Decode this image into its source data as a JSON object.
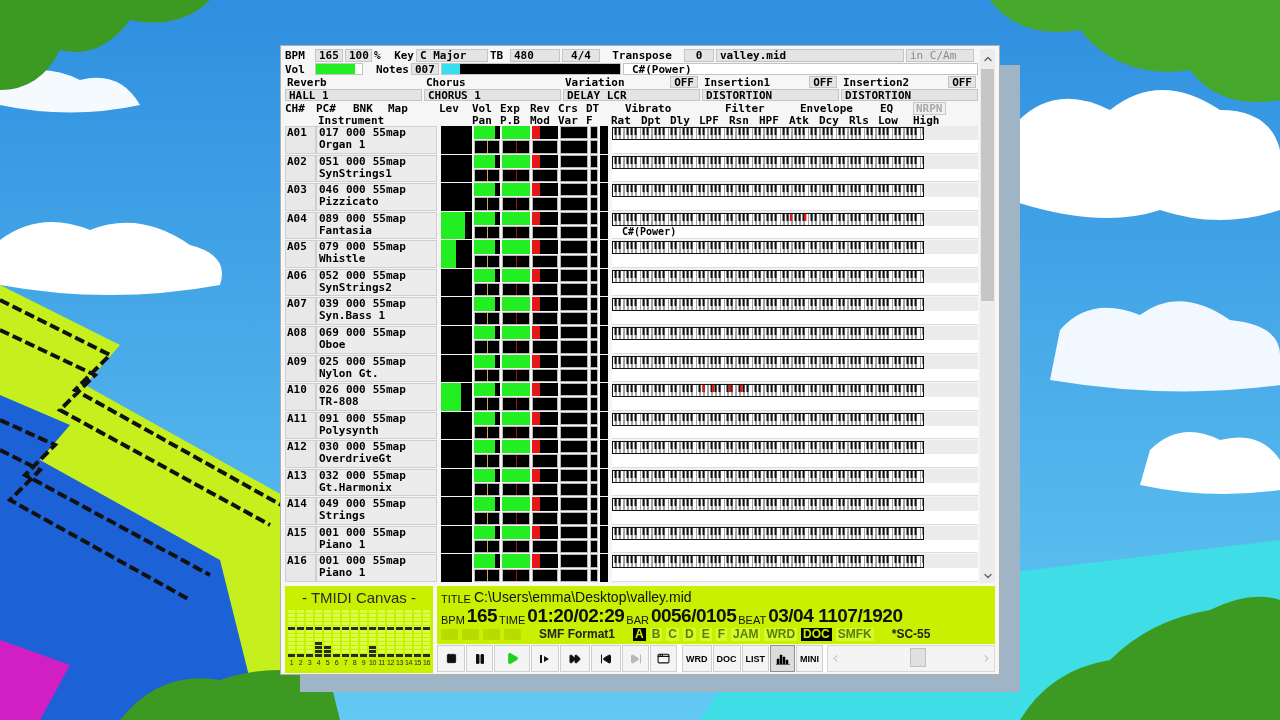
{
  "header": {
    "bpm_label": "BPM",
    "bpm": "165",
    "tempo": "100",
    "percent": "%",
    "key_label": "Key",
    "key": "C Major",
    "tb_label": "TB",
    "tb": "480",
    "time_signature": "4/4",
    "transpose_label": "Transpose",
    "transpose": "0",
    "file": "valley.mid",
    "key_hint": "in C/Am",
    "vol_label": "Vol",
    "vol": {
      "level": 0.85
    },
    "notes_label": "Notes",
    "notes": "007",
    "notes_meter": {
      "level": 0.1
    },
    "chord": "C#(Power)"
  },
  "effects": [
    {
      "label": "Reverb",
      "value": "HALL 1"
    },
    {
      "label": "Chorus",
      "value": "CHORUS 1"
    },
    {
      "label": "Variation",
      "switch": "OFF",
      "on": false,
      "value": "DELAY LCR"
    },
    {
      "label": "Insertion1",
      "switch": "OFF",
      "on": false,
      "value": "DISTORTION"
    },
    {
      "label": "Insertion2",
      "switch": "OFF",
      "on": false,
      "value": "DISTORTION"
    }
  ],
  "columns_top": [
    "CH#",
    "PC#",
    "BNK",
    "Map",
    "Lev",
    "Vol",
    "Exp",
    "Rev",
    "Crs",
    "DT",
    "Vibrato",
    "Filter",
    "Envelope",
    "EQ"
  ],
  "nrpn": {
    "label": "NRPN",
    "disabled": true
  },
  "columns_bottom": [
    "Instrument",
    "Pan",
    "P.B",
    "Mod",
    "Var",
    "F",
    "Rat",
    "Dpt",
    "Dly",
    "LPF",
    "Rsn",
    "HPF",
    "Atk",
    "Dcy",
    "Rls",
    "Low",
    "High"
  ],
  "channels": [
    {
      "ch": "A01",
      "pc": "017",
      "bnk": "000",
      "map": "55map",
      "instrument": "Organ 1",
      "vol": {
        "level": 0.8
      },
      "exp": {
        "level": 1
      },
      "rev": {
        "level": 0.3
      }
    },
    {
      "ch": "A02",
      "pc": "051",
      "bnk": "000",
      "map": "55map",
      "instrument": "SynStrings1",
      "vol": {
        "level": 0.8
      },
      "exp": {
        "level": 1
      },
      "rev": {
        "level": 0.3
      }
    },
    {
      "ch": "A03",
      "pc": "046",
      "bnk": "000",
      "map": "55map",
      "instrument": "Pizzicato",
      "vol": {
        "level": 0.8
      },
      "exp": {
        "level": 1
      },
      "rev": {
        "level": 0.3
      }
    },
    {
      "ch": "A04",
      "pc": "089",
      "bnk": "000",
      "map": "55map",
      "instrument": "Fantasia",
      "lev": {
        "level": 0.77
      },
      "vol": {
        "level": 0.8
      },
      "exp": {
        "level": 1
      },
      "rev": {
        "level": 0.3
      },
      "lit_keys": [
        {
          "level": 0.57
        },
        {
          "level": 0.615
        }
      ],
      "chord": "C#(Power)"
    },
    {
      "ch": "A05",
      "pc": "079",
      "bnk": "000",
      "map": "55map",
      "instrument": "Whistle",
      "lev": {
        "level": 0.47
      },
      "vol": {
        "level": 0.8
      },
      "exp": {
        "level": 1
      },
      "rev": {
        "level": 0.3
      }
    },
    {
      "ch": "A06",
      "pc": "052",
      "bnk": "000",
      "map": "55map",
      "instrument": "SynStrings2",
      "vol": {
        "level": 0.8
      },
      "exp": {
        "level": 1
      },
      "rev": {
        "level": 0.3
      }
    },
    {
      "ch": "A07",
      "pc": "039",
      "bnk": "000",
      "map": "55map",
      "instrument": "Syn.Bass 1",
      "vol": {
        "level": 0.8
      },
      "exp": {
        "level": 1
      },
      "rev": {
        "level": 0.3
      }
    },
    {
      "ch": "A08",
      "pc": "069",
      "bnk": "000",
      "map": "55map",
      "instrument": "Oboe",
      "vol": {
        "level": 0.8
      },
      "exp": {
        "level": 1
      },
      "rev": {
        "level": 0.3
      }
    },
    {
      "ch": "A09",
      "pc": "025",
      "bnk": "000",
      "map": "55map",
      "instrument": "Nylon Gt.",
      "vol": {
        "level": 0.8
      },
      "exp": {
        "level": 1
      },
      "rev": {
        "level": 0.3
      }
    },
    {
      "ch": "A10",
      "pc": "026",
      "bnk": "000",
      "map": "55map",
      "instrument": "TR-808",
      "lev": {
        "level": 0.66
      },
      "vol": {
        "level": 0.8
      },
      "exp": {
        "level": 1
      },
      "rev": {
        "level": 0.3
      },
      "lit_keys": [
        {
          "level": 0.29
        },
        {
          "level": 0.32
        },
        {
          "level": 0.375
        },
        {
          "level": 0.41
        }
      ]
    },
    {
      "ch": "A11",
      "pc": "091",
      "bnk": "000",
      "map": "55map",
      "instrument": "Polysynth",
      "vol": {
        "level": 0.8
      },
      "exp": {
        "level": 1
      },
      "rev": {
        "level": 0.3
      }
    },
    {
      "ch": "A12",
      "pc": "030",
      "bnk": "000",
      "map": "55map",
      "instrument": "OverdriveGt",
      "vol": {
        "level": 0.8
      },
      "exp": {
        "level": 1
      },
      "rev": {
        "level": 0.3
      }
    },
    {
      "ch": "A13",
      "pc": "032",
      "bnk": "000",
      "map": "55map",
      "instrument": "Gt.Harmonix",
      "vol": {
        "level": 0.8
      },
      "exp": {
        "level": 1
      },
      "rev": {
        "level": 0.3
      }
    },
    {
      "ch": "A14",
      "pc": "049",
      "bnk": "000",
      "map": "55map",
      "instrument": "Strings",
      "vol": {
        "level": 0.8
      },
      "exp": {
        "level": 1
      },
      "rev": {
        "level": 0.3
      }
    },
    {
      "ch": "A15",
      "pc": "001",
      "bnk": "000",
      "map": "55map",
      "instrument": "Piano 1",
      "vol": {
        "level": 0.8
      },
      "exp": {
        "level": 1
      },
      "rev": {
        "level": 0.3
      }
    },
    {
      "ch": "A16",
      "pc": "001",
      "bnk": "000",
      "map": "55map",
      "instrument": "Piano 1",
      "vol": {
        "level": 0.8
      },
      "exp": {
        "level": 1
      },
      "rev": {
        "level": 0.3
      }
    }
  ],
  "canvas": {
    "title": "- TMIDI Canvas -",
    "bars": [
      {
        "label": "1",
        "level": 0.08,
        "peak": {
          "level": 0.58
        }
      },
      {
        "label": "2",
        "level": 0.08,
        "peak": {
          "level": 0.58
        }
      },
      {
        "label": "3",
        "level": 0.08,
        "peak": {
          "level": 0.58
        }
      },
      {
        "label": "4",
        "level": 0.33,
        "peak": {
          "level": 0.58
        }
      },
      {
        "label": "5",
        "level": 0.25,
        "peak": {
          "level": 0.58
        }
      },
      {
        "label": "6",
        "level": 0.08,
        "peak": {
          "level": 0.58
        }
      },
      {
        "label": "7",
        "level": 0.08,
        "peak": {
          "level": 0.58
        }
      },
      {
        "label": "8",
        "level": 0.08,
        "peak": {
          "level": 0.58
        }
      },
      {
        "label": "9",
        "level": 0.08,
        "peak": {
          "level": 0.58
        }
      },
      {
        "label": "10",
        "level": 0.25,
        "peak": {
          "level": 0.58
        }
      },
      {
        "label": "11",
        "level": 0.08,
        "peak": {
          "level": 0.58
        }
      },
      {
        "label": "12",
        "level": 0.08,
        "peak": {
          "level": 0.58
        }
      },
      {
        "label": "13",
        "level": 0.08,
        "peak": {
          "level": 0.58
        }
      },
      {
        "label": "14",
        "level": 0.08,
        "peak": {
          "level": 0.58
        }
      },
      {
        "label": "15",
        "level": 0.08,
        "peak": {
          "level": 0.58
        }
      },
      {
        "label": "16",
        "level": 0.08,
        "peak": {
          "level": 0.58
        }
      }
    ]
  },
  "info": {
    "title_label": "TITLE",
    "title": "C:\\Users\\emma\\Desktop\\valley.mid",
    "bpm_label": "BPM",
    "bpm": "165",
    "time_label": "TIME",
    "time": "01:20/02:29",
    "bar_label": "BAR",
    "bar": "0056/0105",
    "beat_label": "BEAT",
    "beat": "03/04",
    "tick": "1107/1920"
  },
  "indicators": [
    {
      "kind": "icon",
      "on": false
    },
    {
      "kind": "icon",
      "on": false
    },
    {
      "kind": "icon",
      "on": false
    },
    {
      "kind": "icon",
      "on": false
    },
    {
      "kind": "text",
      "label": "SMF Format1",
      "on": true
    },
    {
      "kind": "flag",
      "label": "A",
      "on": true
    },
    {
      "kind": "flag",
      "label": "B",
      "on": false
    },
    {
      "kind": "flag",
      "label": "C",
      "on": false
    },
    {
      "kind": "flag",
      "label": "D",
      "on": false
    },
    {
      "kind": "flag",
      "label": "E",
      "on": false
    },
    {
      "kind": "flag",
      "label": "F",
      "on": false
    },
    {
      "kind": "flag",
      "label": "JAM",
      "on": false
    },
    {
      "kind": "flag",
      "label": "WRD",
      "on": false
    },
    {
      "kind": "flag",
      "label": "DOC",
      "on": true
    },
    {
      "kind": "flag",
      "label": "SMFK",
      "on": false
    },
    {
      "kind": "text",
      "label": "*SC-55",
      "on": true
    }
  ],
  "transport": [
    {
      "kind": "stop",
      "on": false,
      "disabled": false
    },
    {
      "kind": "pause",
      "on": false,
      "disabled": false
    },
    {
      "kind": "play",
      "on": true,
      "disabled": false
    },
    {
      "kind": "step",
      "on": false,
      "disabled": false
    },
    {
      "kind": "fast-forward",
      "on": false,
      "disabled": false
    },
    {
      "kind": "previous",
      "on": false,
      "disabled": false
    },
    {
      "kind": "next",
      "on": false,
      "disabled": true
    },
    {
      "kind": "window",
      "on": false,
      "disabled": false
    }
  ],
  "view_buttons": [
    {
      "kind": "text",
      "label": "WRD",
      "pressed": false
    },
    {
      "kind": "text",
      "label": "DOC",
      "pressed": false
    },
    {
      "kind": "text",
      "label": "LIST",
      "pressed": false
    },
    {
      "kind": "bars",
      "pressed": true
    },
    {
      "kind": "text",
      "label": "MINI",
      "pressed": false
    }
  ],
  "seek": {
    "level": 0.55
  }
}
